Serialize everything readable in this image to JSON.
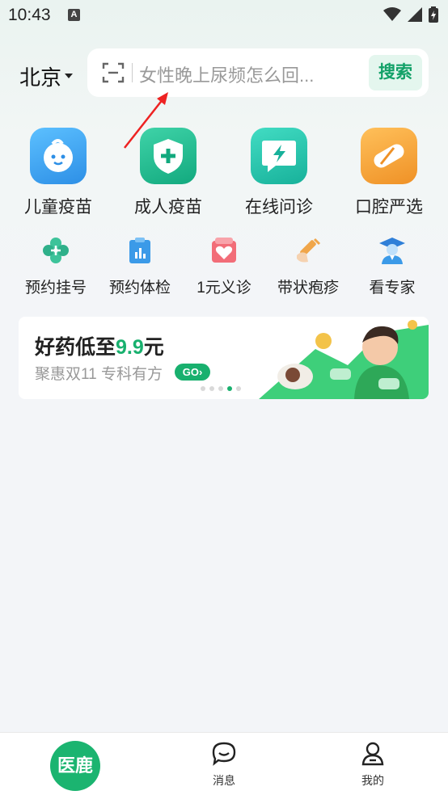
{
  "status_bar": {
    "time": "10:43",
    "notification_letter": "A"
  },
  "header": {
    "city": "北京",
    "search_placeholder": "女性晚上尿频怎么回...",
    "search_button": "搜索"
  },
  "main_grid": [
    {
      "label": "儿童疫苗",
      "icon": "child-face-icon",
      "color": "#3aa4f0"
    },
    {
      "label": "成人疫苗",
      "icon": "shield-plus-icon",
      "color": "#22b893"
    },
    {
      "label": "在线问诊",
      "icon": "chat-lightning-icon",
      "color": "#28c1a8"
    },
    {
      "label": "口腔严选",
      "icon": "tooth-pill-icon",
      "color": "#f0a23a"
    }
  ],
  "sub_grid": [
    {
      "label": "预约挂号",
      "icon": "medical-cross-icon"
    },
    {
      "label": "预约体检",
      "icon": "clipboard-chart-icon"
    },
    {
      "label": "1元义诊",
      "icon": "heart-ticket-icon"
    },
    {
      "label": "带状疱疹",
      "icon": "syringe-hand-icon"
    },
    {
      "label": "看专家",
      "icon": "doctor-cap-icon"
    }
  ],
  "banner": {
    "title_prefix": "好药低至",
    "title_price": "9.9",
    "title_suffix": "元",
    "subtitle": "聚惠双11 专科有方",
    "go": "GO",
    "dots_total": 5,
    "dots_active_index": 3
  },
  "bottom_nav": {
    "home": "医鹿",
    "messages": "消息",
    "mine": "我的"
  },
  "colors": {
    "brand_green": "#18b06e"
  }
}
